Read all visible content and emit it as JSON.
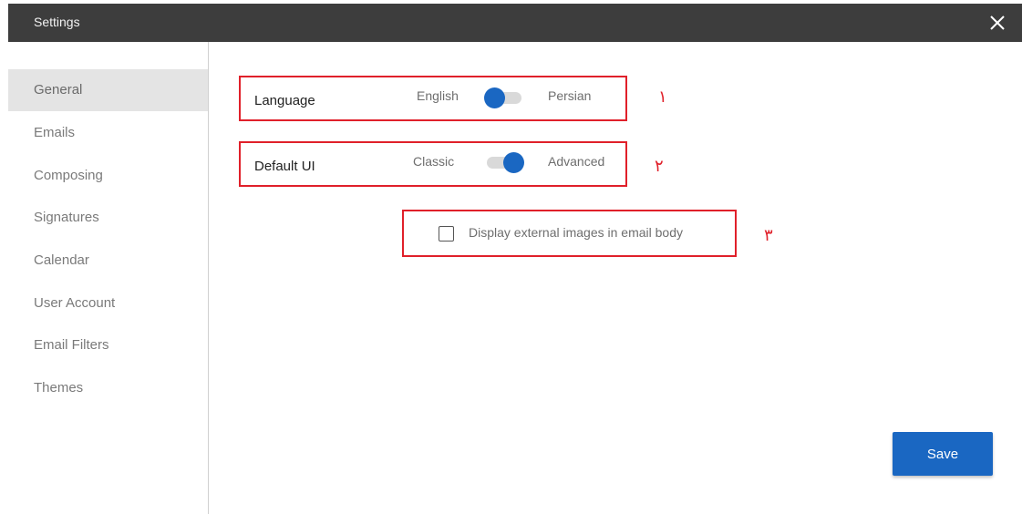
{
  "window": {
    "title": "Settings",
    "close_icon": "close-icon"
  },
  "sidebar": {
    "items": [
      {
        "label": "General",
        "active": true
      },
      {
        "label": "Emails",
        "active": false
      },
      {
        "label": "Composing",
        "active": false
      },
      {
        "label": "Signatures",
        "active": false
      },
      {
        "label": "Calendar",
        "active": false
      },
      {
        "label": "User Account",
        "active": false
      },
      {
        "label": "Email Filters",
        "active": false
      },
      {
        "label": "Themes",
        "active": false
      }
    ]
  },
  "settings": {
    "language": {
      "label": "Language",
      "option_left": "English",
      "option_right": "Persian",
      "selected": "English",
      "marker": "١"
    },
    "default_ui": {
      "label": "Default UI",
      "option_left": "Classic",
      "option_right": "Advanced",
      "selected": "Advanced",
      "marker": "٢"
    },
    "external_images": {
      "label": "Display external images in email body",
      "checked": false,
      "marker": "٣"
    }
  },
  "actions": {
    "save_label": "Save"
  },
  "colors": {
    "titlebar": "#3d3d3d",
    "accent": "#1a67c2",
    "annotation": "#e0202a",
    "active_nav": "#e4e4e4"
  }
}
